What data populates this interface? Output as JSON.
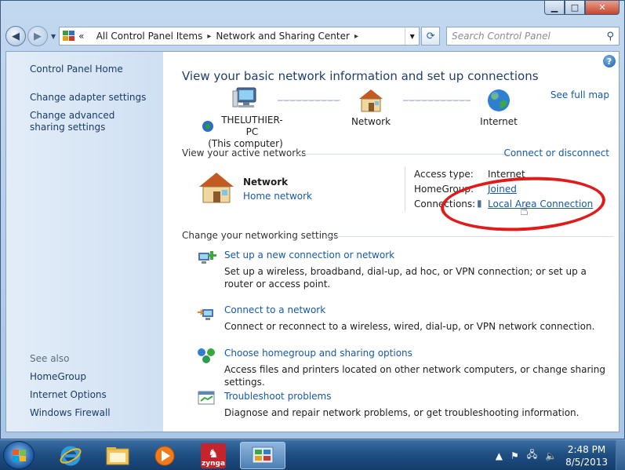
{
  "window": {
    "caption_buttons": {
      "minimize": "▁",
      "maximize": "□",
      "close": "✕"
    }
  },
  "toolbar": {
    "back_icon": "back-arrow-icon",
    "forward_icon": "forward-arrow-icon",
    "breadcrumb_overflow": "«",
    "breadcrumb": [
      "All Control Panel Items",
      "Network and Sharing Center"
    ],
    "search_placeholder": "Search Control Panel"
  },
  "sidebar": {
    "home": "Control Panel Home",
    "links": [
      "Change adapter settings",
      "Change advanced sharing settings"
    ],
    "see_also_label": "See also",
    "see_also": [
      "HomeGroup",
      "Internet Options",
      "Windows Firewall"
    ]
  },
  "main": {
    "help": "?",
    "title": "View your basic network information and set up connections",
    "see_full_map": "See full map",
    "map": {
      "computer_name": "THELUTHIER-PC",
      "computer_sub": "(This computer)",
      "network": "Network",
      "internet": "Internet"
    },
    "active_networks": {
      "heading": "View your active networks",
      "connect_link": "Connect or disconnect",
      "network_name": "Network",
      "network_type": "Home network",
      "access_type_label": "Access type:",
      "access_type_value": "Internet",
      "homegroup_label": "HomeGroup:",
      "homegroup_value": "Joined",
      "connections_label": "Connections:",
      "connections_value": "Local Area Connection"
    },
    "change_settings": {
      "heading": "Change your networking settings",
      "tasks": [
        {
          "title": "Set up a new connection or network",
          "desc": "Set up a wireless, broadband, dial-up, ad hoc, or VPN connection; or set up a router or access point."
        },
        {
          "title": "Connect to a network",
          "desc": "Connect or reconnect to a wireless, wired, dial-up, or VPN network connection."
        },
        {
          "title": "Choose homegroup and sharing options",
          "desc": "Access files and printers located on other network computers, or change sharing settings."
        },
        {
          "title": "Troubleshoot problems",
          "desc": "Diagnose and repair network problems, or get troubleshooting information."
        }
      ]
    }
  },
  "taskbar": {
    "apps": [
      "internet-explorer-icon",
      "windows-explorer-icon",
      "media-player-icon",
      "zynga-icon",
      "control-panel-icon"
    ],
    "zynga_label": "zynga",
    "clock_time": "2:48 PM",
    "clock_date": "8/5/2013"
  },
  "colors": {
    "link": "#1659a5",
    "title": "#1e3e6e",
    "annotation": "#e01b1b"
  }
}
